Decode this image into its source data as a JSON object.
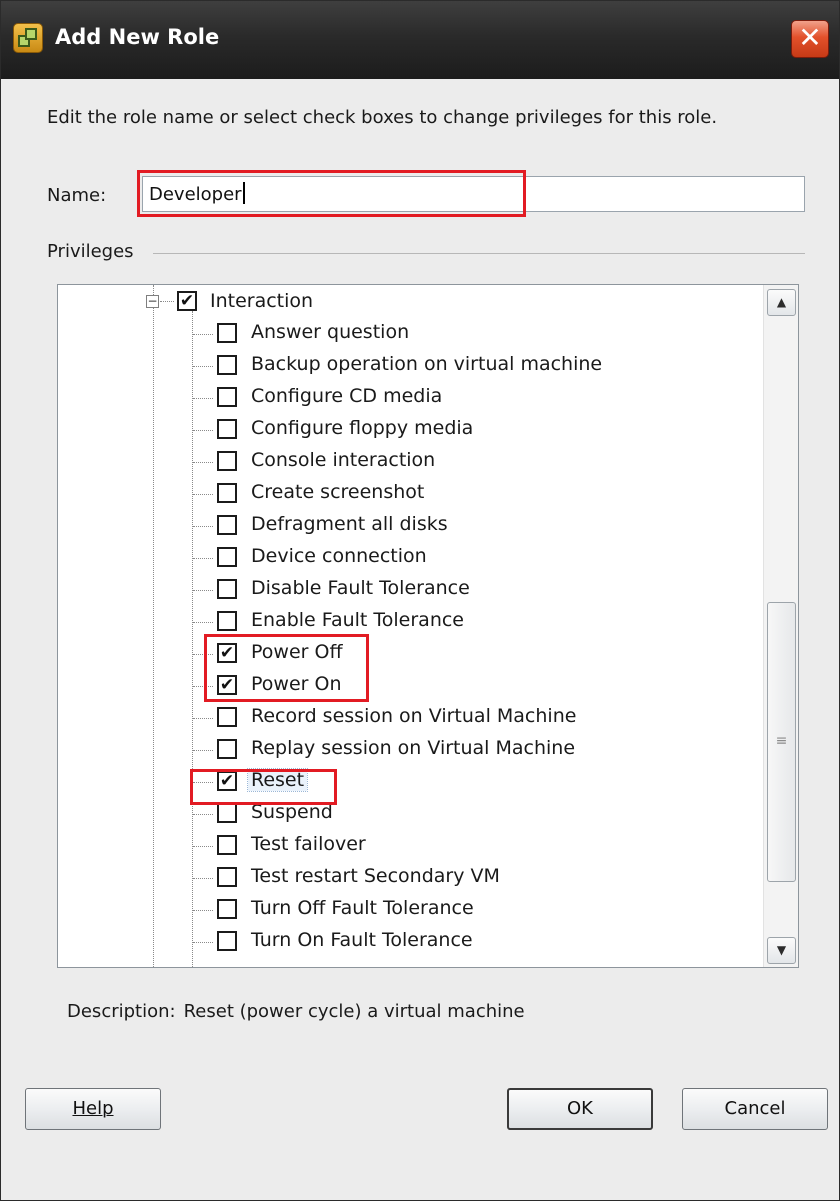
{
  "window": {
    "title": "Add New Role",
    "close_glyph": "✕",
    "icon": "vsphere-app-icon"
  },
  "instruction": "Edit the role name or select check boxes to change privileges for this role.",
  "name_field": {
    "label": "Name:",
    "value": "Developer"
  },
  "privileges": {
    "label": "Privileges",
    "parent": {
      "label": "Interaction",
      "checked": true,
      "expander_glyph": "−"
    },
    "items": [
      {
        "label": "Answer question",
        "checked": false
      },
      {
        "label": "Backup operation on virtual machine",
        "checked": false
      },
      {
        "label": "Configure CD media",
        "checked": false
      },
      {
        "label": "Configure floppy media",
        "checked": false
      },
      {
        "label": "Console interaction",
        "checked": false
      },
      {
        "label": "Create screenshot",
        "checked": false
      },
      {
        "label": "Defragment all disks",
        "checked": false
      },
      {
        "label": "Device connection",
        "checked": false
      },
      {
        "label": "Disable Fault Tolerance",
        "checked": false
      },
      {
        "label": "Enable Fault Tolerance",
        "checked": false
      },
      {
        "label": "Power Off",
        "checked": true
      },
      {
        "label": "Power On",
        "checked": true
      },
      {
        "label": "Record session on Virtual Machine",
        "checked": false
      },
      {
        "label": "Replay session on Virtual Machine",
        "checked": false
      },
      {
        "label": "Reset",
        "checked": true,
        "selected": true
      },
      {
        "label": "Suspend",
        "checked": false
      },
      {
        "label": "Test failover",
        "checked": false
      },
      {
        "label": "Test restart Secondary VM",
        "checked": false
      },
      {
        "label": "Turn Off Fault Tolerance",
        "checked": false
      },
      {
        "label": "Turn On Fault Tolerance",
        "checked": false
      }
    ],
    "check_glyph": "✔"
  },
  "scrollbar": {
    "up_glyph": "▲",
    "down_glyph": "▼",
    "grip_glyph": "≡"
  },
  "description": {
    "label": "Description:",
    "text": "Reset (power cycle) a virtual machine"
  },
  "buttons": {
    "help": "Help",
    "ok": "OK",
    "cancel": "Cancel"
  },
  "colors": {
    "highlight_box": "#e21b23",
    "title_bar": "#2a2a2a",
    "close_button": "#e2512b"
  }
}
